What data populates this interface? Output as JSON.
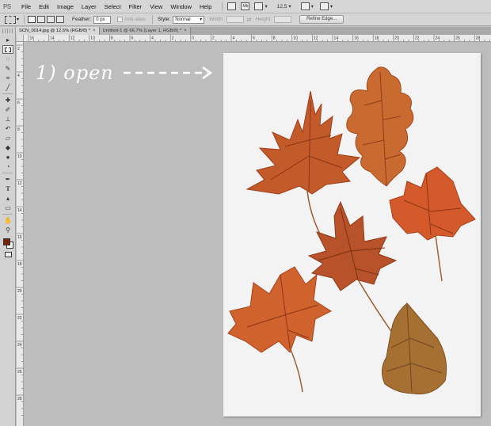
{
  "app": {
    "logo": "PS"
  },
  "menu": [
    "File",
    "Edit",
    "Image",
    "Layer",
    "Select",
    "Filter",
    "View",
    "Window",
    "Help"
  ],
  "menubar_extras": {
    "mb_label": "Mb",
    "zoom": "12,5"
  },
  "options": {
    "feather_label": "Feather:",
    "feather_value": "0 px",
    "antialias_label": "Anti-alias",
    "style_label": "Style:",
    "style_value": "Normal",
    "width_label": "Width:",
    "height_label": "Height:",
    "refine_edge": "Refine Edge..."
  },
  "tabs": [
    {
      "label": "SCN_0014.jpg @ 12,5% (RGB/8) *",
      "active": true
    },
    {
      "label": "Untitled-1 @ 66,7% (Layer 1, RGB/8) *",
      "active": false
    }
  ],
  "ruler": {
    "h_labels": [
      "16",
      "14",
      "12",
      "10",
      "8",
      "6",
      "4",
      "2",
      "0",
      "2",
      "4",
      "6",
      "8",
      "10",
      "12",
      "14",
      "16",
      "18",
      "20",
      "22",
      "24",
      "26",
      "28"
    ],
    "v_labels": [
      "2",
      "4",
      "6",
      "8",
      "10",
      "12",
      "14",
      "16",
      "18",
      "20",
      "22",
      "24",
      "26",
      "28"
    ]
  },
  "annotation": {
    "text": "1) open"
  },
  "colors": {
    "foreground": "#7a2308",
    "background": "#ffffff",
    "canvas": "#bdbdbd",
    "annotation": "#ffffff"
  },
  "image_content": "pressed autumn leaves"
}
